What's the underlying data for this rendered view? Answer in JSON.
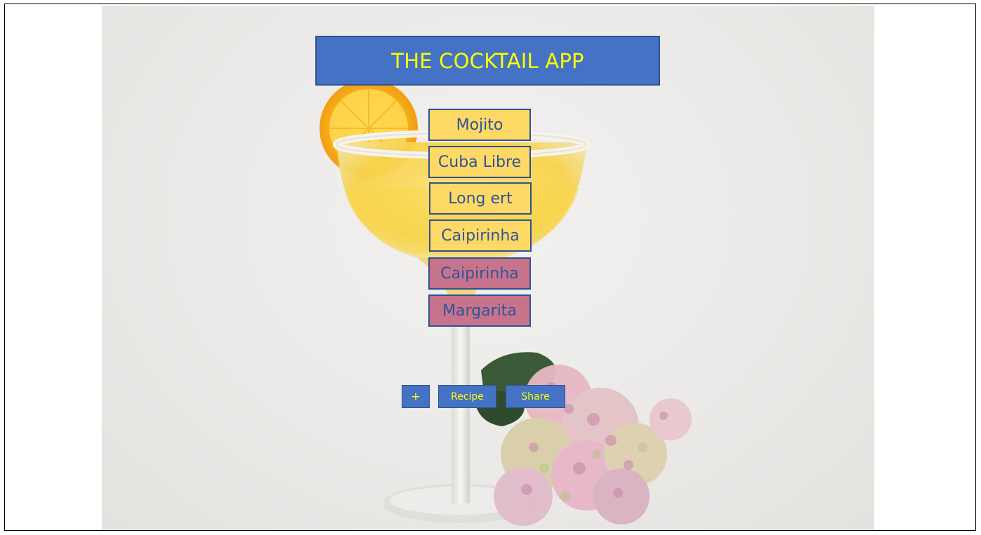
{
  "app": {
    "title": "THE COCKTAIL APP"
  },
  "drinks": [
    {
      "label": "Mojito",
      "color": "#ffd966"
    },
    {
      "label": "Cuba Libre",
      "color": "#ffd966"
    },
    {
      "label": "Long ert",
      "color": "#ffd966"
    },
    {
      "label": "Caipirinha",
      "color": "#ffd966"
    },
    {
      "label": "Caipirinha",
      "color": "#c8738c"
    },
    {
      "label": "Margarita",
      "color": "#c8738c"
    }
  ],
  "actions": {
    "add_label": "+",
    "recipe_label": "Recipe",
    "share_label": "Share"
  },
  "colors": {
    "title_bg": "#4472c4",
    "title_text": "#ffff00",
    "item_text": "#2f5597",
    "border": "#2f528f"
  },
  "background": {
    "image": "cocktail-photo"
  }
}
